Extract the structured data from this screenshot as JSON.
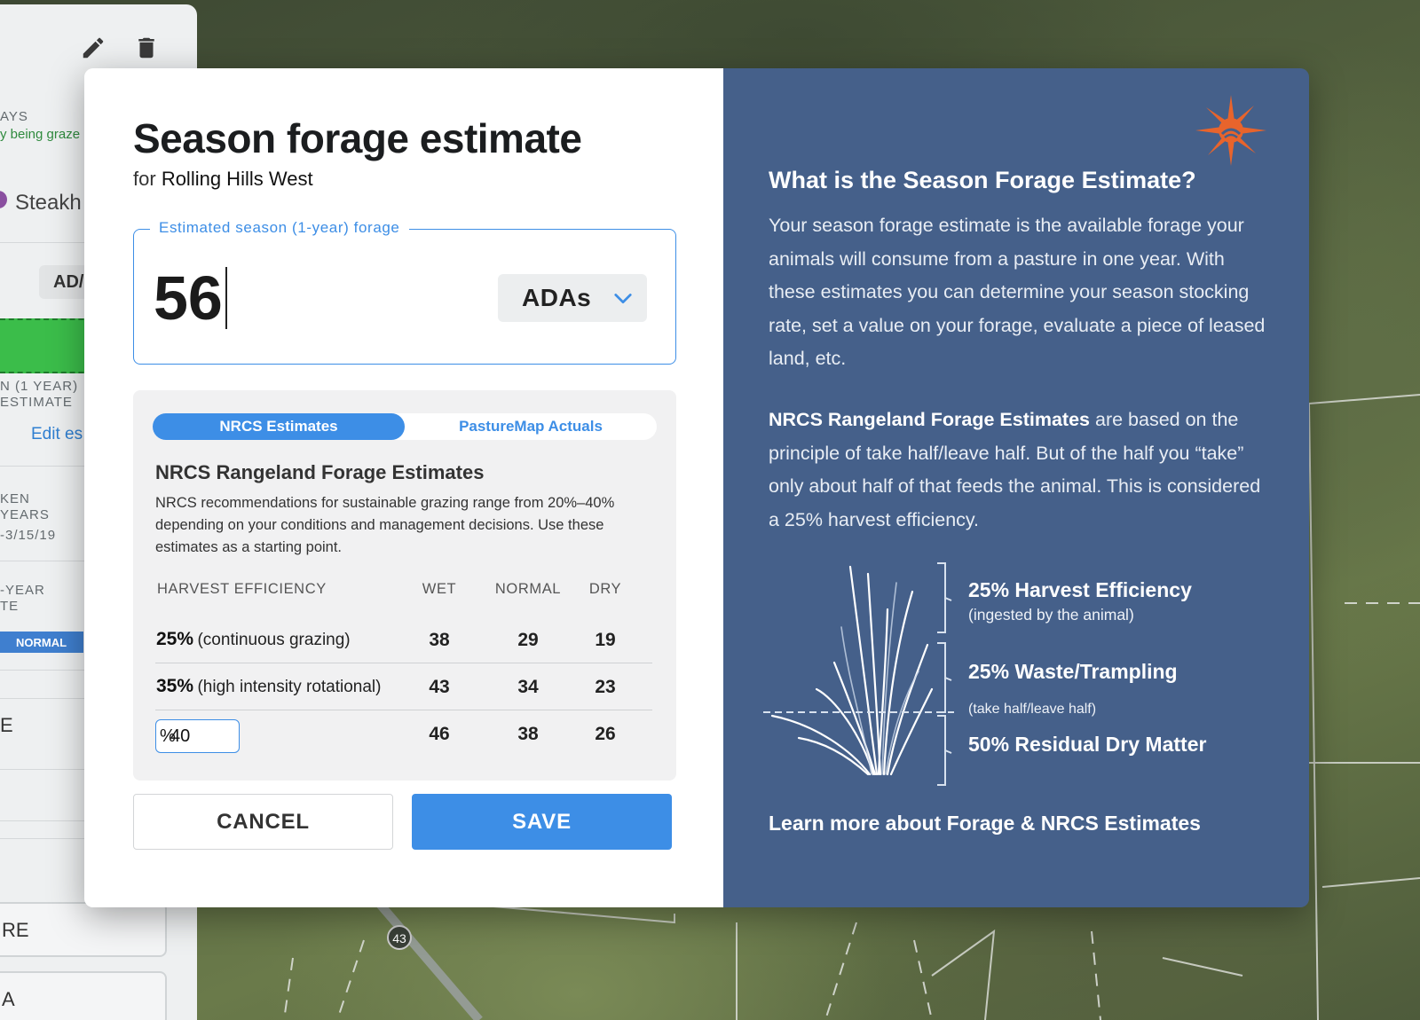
{
  "background_panel": {
    "label_days": "AYS",
    "label_being_grazed": "y being graze",
    "label_herd": "Steakh",
    "label_chip": "AD/",
    "label_season_1": "N (1 YEAR)",
    "label_season_2": "ESTIMATE",
    "label_edit": "Edit es",
    "label_taken_1": "KEN",
    "label_taken_2": "YEARS",
    "label_taken_3": "-3/15/19",
    "label_year_1": "-YEAR",
    "label_year_2": "TE",
    "label_badge": "NORMAL",
    "label_e": "E",
    "label_btn_1": "RE",
    "label_btn_2": "A"
  },
  "map": {
    "road_marker": "43"
  },
  "modal": {
    "title": "Season forage estimate",
    "subtitle_prefix": "for",
    "subtitle_farm": "Rolling Hills West",
    "forage_field": {
      "legend": "Estimated season (1-year) forage",
      "value": "56",
      "unit": "ADAs"
    },
    "tabs": [
      {
        "label": "NRCS Estimates",
        "active": true
      },
      {
        "label": "PastureMap Actuals",
        "active": false
      }
    ],
    "nrcs": {
      "title": "NRCS Rangeland Forage Estimates",
      "description": "NRCS recommendations for sustainable grazing range from 20%–40% depending on your conditions and management decisions. Use these estimates as a starting point.",
      "columns": [
        "HARVEST EFFICIENCY",
        "WET",
        "NORMAL",
        "DRY"
      ],
      "rows": [
        {
          "pct": "25%",
          "method": "(continuous grazing)",
          "wet": "38",
          "normal": "29",
          "dry": "19"
        },
        {
          "pct": "35%",
          "method": "(high intensity rotational)",
          "wet": "43",
          "normal": "34",
          "dry": "23"
        },
        {
          "custom_value": "40",
          "custom_suffix": "%",
          "wet": "46",
          "normal": "38",
          "dry": "26"
        }
      ]
    },
    "buttons": {
      "cancel": "CANCEL",
      "save": "SAVE"
    }
  },
  "info_panel": {
    "title": "What is the Season Forage Estimate?",
    "paragraph_1": "Your season forage estimate is the available forage your animals will consume from a pasture in one year. With these estimates you can determine your season stocking rate, set a value on your forage, evaluate a piece of leased land, etc.",
    "paragraph_2_bold": "NRCS Rangeland Forage Estimates",
    "paragraph_2_rest": " are based on the principle of take half/leave half. But of the half you “take” only about half of that feeds the animal. This is considered a 25% harvest efficiency.",
    "diagram": {
      "harvest_label": "25% Harvest Efficiency",
      "harvest_sub": "(ingested by the animal)",
      "waste_label": "25% Waste/Trampling",
      "split_note": "(take half/leave half)",
      "residual_label": "50% Residual Dry Matter"
    },
    "learn_more": "Learn more about Forage & NRCS Estimates"
  },
  "colors": {
    "accent": "#3d8ee6",
    "info_bg": "#45608a",
    "logo": "#e8642c"
  },
  "icons": [
    "pencil-icon",
    "trash-icon",
    "chevron-down-icon",
    "sun-logo-icon",
    "grass-icon"
  ]
}
